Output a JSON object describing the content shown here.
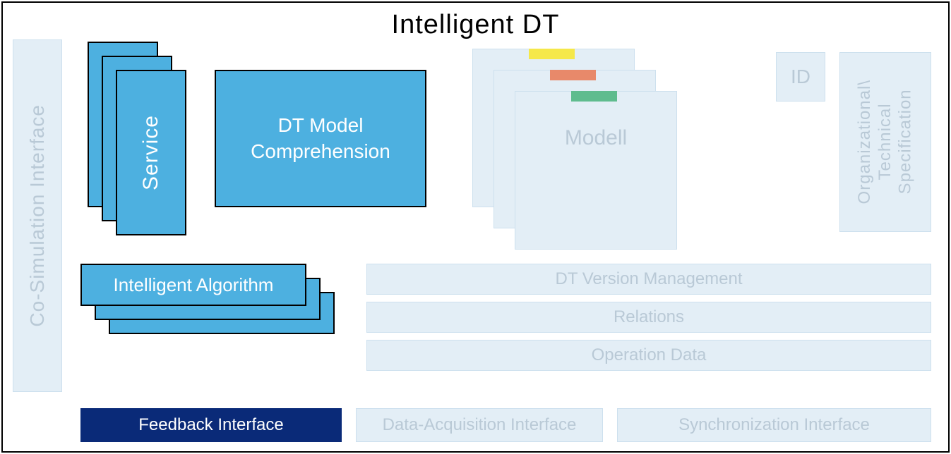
{
  "title": "Intelligent  DT",
  "left_rail": {
    "label": "Co-Simulation Interface"
  },
  "service": {
    "label": "Service"
  },
  "dt_comp": {
    "label": "DT Model\nComprehension"
  },
  "modell": {
    "label": "Modell"
  },
  "id_box": {
    "label": "ID"
  },
  "orgtech": {
    "line1": "Organizational\\",
    "line2": "Technical",
    "line3": "Specification"
  },
  "algorithm": {
    "label": "Intelligent  Algorithm"
  },
  "bars": {
    "version": "DT Version Management",
    "relations": "Relations",
    "opdata": "Operation Data"
  },
  "bottom": {
    "feedback": "Feedback Interface",
    "daq": "Data-Acquisition  Interface",
    "sync": "Synchronization  Interface"
  }
}
